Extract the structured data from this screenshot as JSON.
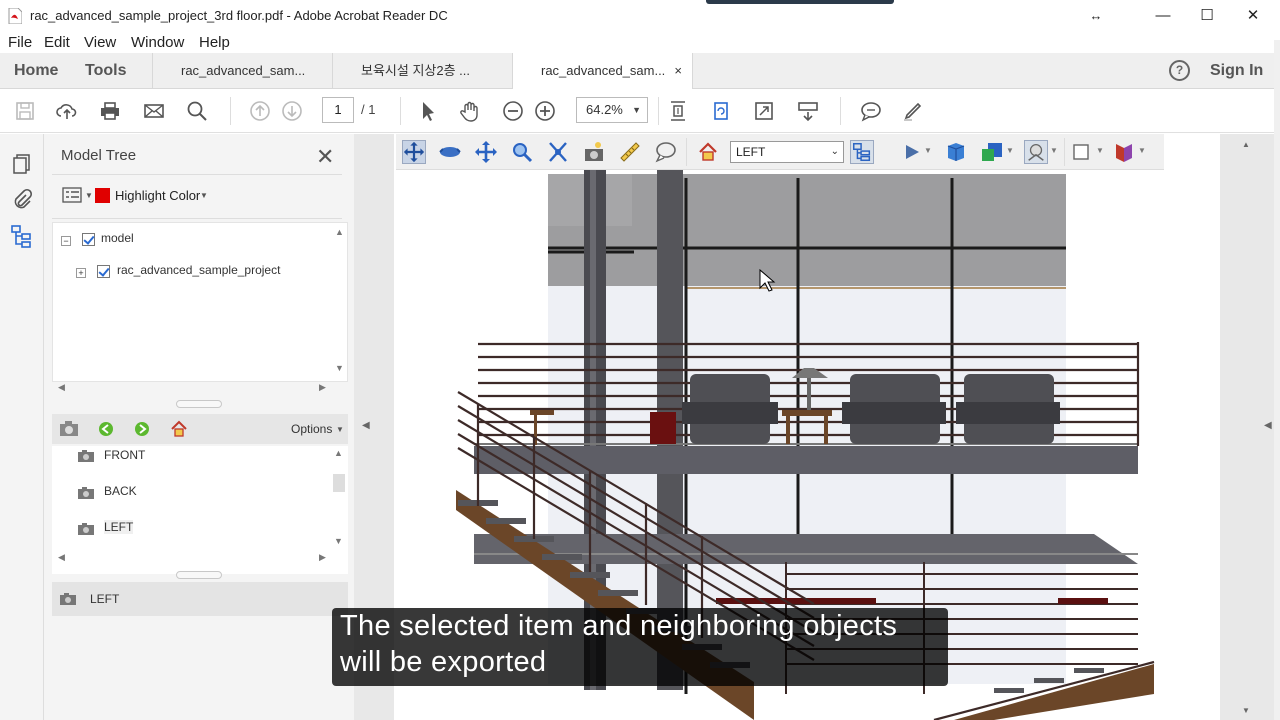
{
  "window": {
    "title": "rac_advanced_sample_project_3rd floor.pdf - Adobe Acrobat Reader DC",
    "minimize_glyph": "—",
    "maximize_glyph": "☐",
    "close_glyph": "✕",
    "resize_glyph": "↔"
  },
  "menu": [
    "File",
    "Edit",
    "View",
    "Window",
    "Help"
  ],
  "tabs": {
    "home": "Home",
    "tools": "Tools",
    "docs": [
      {
        "label": "rac_advanced_sam...",
        "active": false
      },
      {
        "label": "보육시설 지상2층 ...",
        "active": false
      },
      {
        "label": "rac_advanced_sam...",
        "active": true
      }
    ],
    "close_glyph": "×",
    "help_glyph": "?",
    "sign_in": "Sign In"
  },
  "toolbar": {
    "page_current": "1",
    "page_total": "/ 1",
    "zoom": "64.2%"
  },
  "model_tree": {
    "title": "Model Tree",
    "highlight_label": "Highlight Color",
    "highlight_color": "#e00000",
    "items": [
      {
        "label": "model"
      },
      {
        "label": "rac_advanced_sample_project"
      }
    ],
    "options_label": "Options",
    "views": [
      "FRONT",
      "BACK",
      "LEFT"
    ],
    "selected_view": "LEFT"
  },
  "toolbar_3d": {
    "view_select": "LEFT"
  },
  "caption": {
    "line1": "The selected item and neighboring objects",
    "line2": "will be exported"
  },
  "colors": {
    "accent_red": "#e00000",
    "stair_wood": "#6b4628",
    "rail": "#3d2a28",
    "caption_bg": "#000000"
  }
}
